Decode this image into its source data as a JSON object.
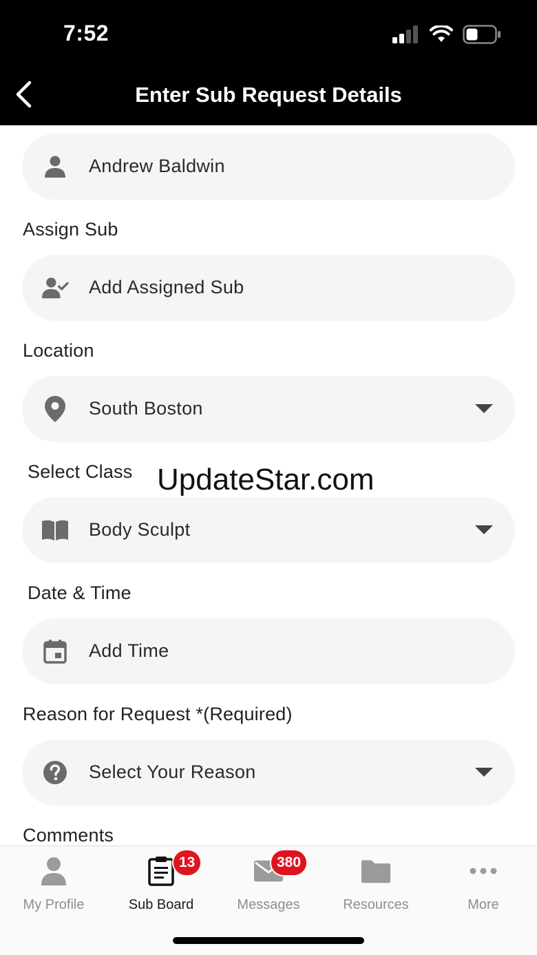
{
  "status_bar": {
    "time": "7:52"
  },
  "nav": {
    "title": "Enter Sub Request Details"
  },
  "form": {
    "instructor": {
      "value": "Andrew Baldwin",
      "icon": "person-icon"
    },
    "assign_sub": {
      "label": "Assign Sub",
      "placeholder": "Add Assigned Sub",
      "icon": "person-check-icon"
    },
    "location": {
      "label": "Location",
      "value": "South Boston",
      "icon": "map-pin-icon"
    },
    "select_class": {
      "label": "Select Class",
      "value": "Body Sculpt",
      "icon": "book-icon"
    },
    "date_time": {
      "label": "Date & Time",
      "placeholder": "Add Time",
      "icon": "calendar-icon"
    },
    "reason": {
      "label": "Reason for Request *(Required)",
      "placeholder": "Select Your Reason",
      "icon": "question-icon"
    },
    "comments": {
      "label": "Comments"
    }
  },
  "watermark": "UpdateStar.com",
  "tabs": [
    {
      "label": "My Profile",
      "icon": "profile-icon",
      "active": false
    },
    {
      "label": "Sub Board",
      "icon": "clipboard-icon",
      "active": true,
      "badge": "13"
    },
    {
      "label": "Messages",
      "icon": "mail-icon",
      "active": false,
      "badge": "380"
    },
    {
      "label": "Resources",
      "icon": "folder-icon",
      "active": false
    },
    {
      "label": "More",
      "icon": "more-icon",
      "active": false
    }
  ],
  "colors": {
    "header_bg": "#000000",
    "badge": "#e0141e",
    "field_bg": "#f5f5f5",
    "inactive_tab": "#8e8e8e"
  }
}
